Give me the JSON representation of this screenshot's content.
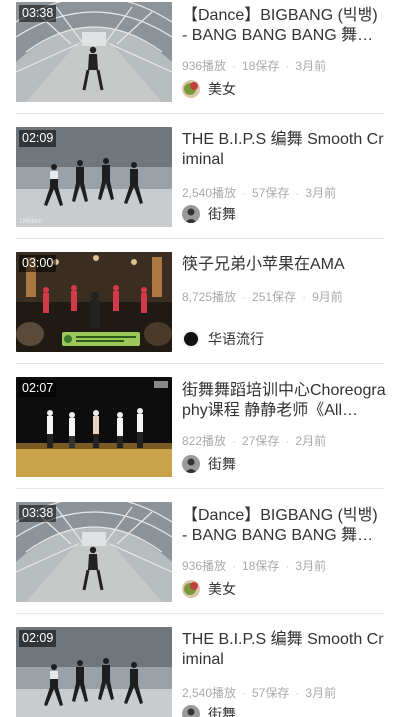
{
  "feed": {
    "items": [
      {
        "duration": "03:38",
        "title": "【Dance】BIGBANG (빅뱅) - BANG BANG BANG 舞…",
        "views": "936播放",
        "saves": "18保存",
        "age": "3月前",
        "channel": "美女"
      },
      {
        "duration": "02:09",
        "title": "THE B.I.P.S 编舞 Smooth Criminal",
        "views": "2,540播放",
        "saves": "57保存",
        "age": "3月前",
        "channel": "街舞"
      },
      {
        "duration": "03:00",
        "title": "筷子兄弟小苹果在AMA",
        "views": "8,725播放",
        "saves": "251保存",
        "age": "9月前",
        "channel": "华语流行"
      },
      {
        "duration": "02:07",
        "title": "街舞舞蹈培训中心Choreography课程 静静老师《All…",
        "views": "822播放",
        "saves": "27保存",
        "age": "2月前",
        "channel": "街舞"
      },
      {
        "duration": "03:38",
        "title": "【Dance】BIGBANG (빅뱅) - BANG BANG BANG 舞…",
        "views": "936播放",
        "saves": "18保存",
        "age": "3月前",
        "channel": "美女"
      },
      {
        "duration": "02:09",
        "title": "THE B.I.P.S 编舞 Smooth Criminal",
        "views": "2,540播放",
        "saves": "57保存",
        "age": "3月前",
        "channel": "街舞"
      }
    ]
  }
}
